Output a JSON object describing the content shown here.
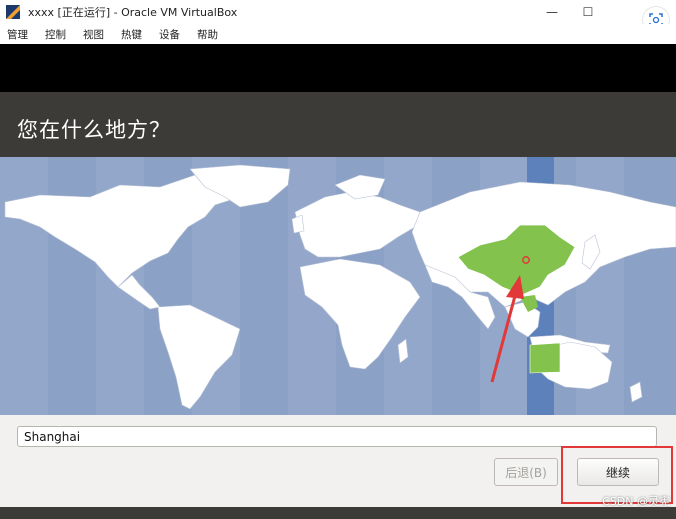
{
  "window": {
    "title": "xxxx [正在运行] - Oracle VM VirtualBox"
  },
  "menu": [
    "管理",
    "控制",
    "视图",
    "热键",
    "设备",
    "帮助"
  ],
  "installer": {
    "title": "您在什么地方？",
    "timezone_value": "Shanghai",
    "back_label": "后退(B)",
    "continue_label": "继续"
  },
  "watermark": "CSDN @灵宪",
  "colors": {
    "ocean": "#8ca1c6",
    "land": "#ffffff",
    "selected_region": "#83c24d",
    "timezone_band": "#5d81bb",
    "installer_bg": "#3c3b37",
    "annotation": "#e23838"
  },
  "icons": {
    "app": "virtualbox-icon",
    "minimize": "minimize-icon",
    "maximize": "maximize-icon",
    "close": "close-icon",
    "side": "scan-icon"
  }
}
